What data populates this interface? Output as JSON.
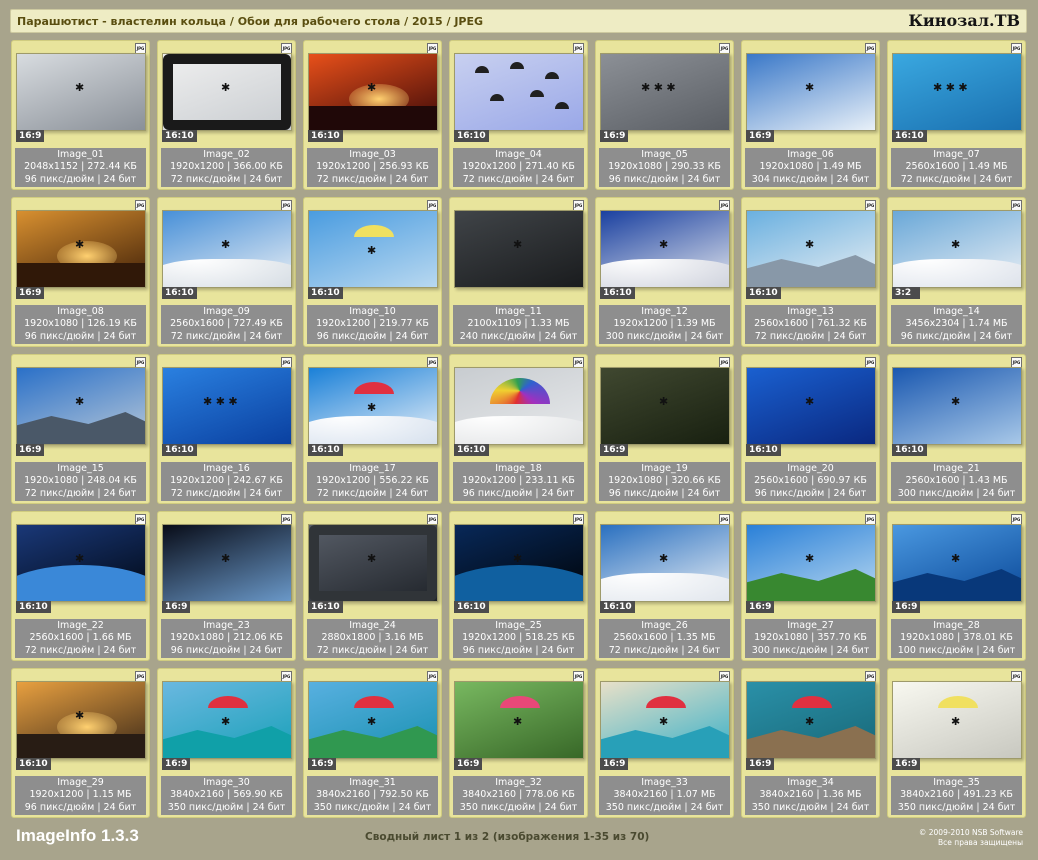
{
  "header": {
    "path": "Парашютист - властелин кольца / Обои для рабочего стола / 2015 / JPEG",
    "brand": "Кинозал.ТВ"
  },
  "footer": {
    "app_name": "ImageInfo 1.3.3",
    "summary": "Сводный лист 1 из 2 (изображения 1-35 из 70)",
    "copyright": "© 2009-2010 NSB Software",
    "rights": "Все права защищены"
  },
  "format_label": "JPG",
  "icons": {
    "format_badge": "jpg-file-icon"
  },
  "images": [
    {
      "name": "Image_01",
      "ratio": "16:9",
      "dims": "2048x1152 | 272.44 КБ",
      "info": "96 пикс/дюйм | 24 бит",
      "sky": "#d8dce0",
      "sky2": "#8a9098",
      "ground": "#3a3e44",
      "scene": "air"
    },
    {
      "name": "Image_02",
      "ratio": "16:10",
      "dims": "1920x1200 | 366.00 КБ",
      "info": "72 пикс/дюйм | 24 бит",
      "sky": "#f0f0f0",
      "sky2": "#c8ccd0",
      "ground": "#1a1a1a",
      "scene": "plane"
    },
    {
      "name": "Image_03",
      "ratio": "16:10",
      "dims": "1920x1200 | 256.93 КБ",
      "info": "72 пикс/дюйм | 24 бит",
      "sky": "#e8501a",
      "sky2": "#3a0808",
      "ground": "#200808",
      "scene": "sunset"
    },
    {
      "name": "Image_04",
      "ratio": "16:10",
      "dims": "1920x1200 | 271.40 КБ",
      "info": "72 пикс/дюйм | 24 бит",
      "sky": "#c8d0f0",
      "sky2": "#9aa8e8",
      "ground": "#b0bce8",
      "scene": "many"
    },
    {
      "name": "Image_05",
      "ratio": "16:9",
      "dims": "1920x1080 | 290.33 КБ",
      "info": "96 пикс/дюйм | 24 бит",
      "sky": "#8c9096",
      "sky2": "#5a5e64",
      "ground": "#6e7276",
      "scene": "formation"
    },
    {
      "name": "Image_06",
      "ratio": "16:9",
      "dims": "1920x1080 | 1.49 МБ",
      "info": "304 пикс/дюйм | 24 бит",
      "sky": "#3a78c8",
      "sky2": "#e8f0f8",
      "ground": "#2060b0",
      "scene": "freefall"
    },
    {
      "name": "Image_07",
      "ratio": "16:10",
      "dims": "2560x1600 | 1.49 МБ",
      "info": "72 пикс/дюйм | 24 бит",
      "sky": "#3aa8e0",
      "sky2": "#1a70b0",
      "ground": "#1a88c8",
      "scene": "ring"
    },
    {
      "name": "Image_08",
      "ratio": "16:9",
      "dims": "1920x1080 | 126.19 КБ",
      "info": "96 пикс/дюйм | 24 бит",
      "sky": "#d89030",
      "sky2": "#402008",
      "ground": "#301808",
      "scene": "sunset"
    },
    {
      "name": "Image_09",
      "ratio": "16:10",
      "dims": "2560x1600 | 727.49 КБ",
      "info": "72 пикс/дюйм | 24 бит",
      "sky": "#4890d8",
      "sky2": "#e8eef4",
      "ground": "#d0d8e0",
      "scene": "clouds"
    },
    {
      "name": "Image_10",
      "ratio": "16:10",
      "dims": "1920x1200 | 219.77 КБ",
      "info": "96 пикс/дюйм | 24 бит",
      "sky": "#4a9ce0",
      "sky2": "#b8d8f0",
      "ground": "#2a78c8",
      "scene": "paraglider"
    },
    {
      "name": "Image_11",
      "ratio": "",
      "dims": "2100x1109 | 1.33 МБ",
      "info": "240 пикс/дюйм | 24 бит",
      "sky": "#404448",
      "sky2": "#1a1c1e",
      "ground": "#2a2c2e",
      "scene": "dark"
    },
    {
      "name": "Image_12",
      "ratio": "16:10",
      "dims": "1920x1200 | 1.39 МБ",
      "info": "300 пикс/дюйм | 24 бит",
      "sky": "#1a40a0",
      "sky2": "#e0e4ec",
      "ground": "#c8ccd8",
      "scene": "clouds"
    },
    {
      "name": "Image_13",
      "ratio": "16:10",
      "dims": "2560x1600 | 761.32 КБ",
      "info": "72 пикс/дюйм | 24 бит",
      "sky": "#6ab0e0",
      "sky2": "#e8eef2",
      "ground": "#8898a8",
      "scene": "mountain"
    },
    {
      "name": "Image_14",
      "ratio": "3:2",
      "dims": "3456x2304 | 1.74 МБ",
      "info": "96 пикс/дюйм | 24 бит",
      "sky": "#6aa8d8",
      "sky2": "#e8eef4",
      "ground": "#d8dee8",
      "scene": "tandem"
    },
    {
      "name": "Image_15",
      "ratio": "16:9",
      "dims": "1920x1080 | 248.04 КБ",
      "info": "72 пикс/дюйм | 24 бит",
      "sky": "#2a70c8",
      "sky2": "#b8c8d8",
      "ground": "#4a5868",
      "scene": "city"
    },
    {
      "name": "Image_16",
      "ratio": "16:10",
      "dims": "1920x1200 | 242.67 КБ",
      "info": "72 пикс/дюйм | 24 бит",
      "sky": "#2a80e0",
      "sky2": "#0a40a0",
      "ground": "#1a60c0",
      "scene": "formation"
    },
    {
      "name": "Image_17",
      "ratio": "16:10",
      "dims": "1920x1200 | 556.22 КБ",
      "info": "72 пикс/дюйм | 24 бит",
      "sky": "#1a80d8",
      "sky2": "#e8f0f8",
      "ground": "#d0dceb",
      "scene": "redwing"
    },
    {
      "name": "Image_18",
      "ratio": "16:10",
      "dims": "1920x1200 | 233.11 КБ",
      "info": "96 пикс/дюйм | 24 бит",
      "sky": "#c8ccd0",
      "sky2": "#e8eaec",
      "ground": "#dcdee0",
      "scene": "rainbow"
    },
    {
      "name": "Image_19",
      "ratio": "16:9",
      "dims": "1920x1080 | 320.66 КБ",
      "info": "96 пикс/дюйм | 24 бит",
      "sky": "#404830",
      "sky2": "#182010",
      "ground": "#284018",
      "scene": "dark"
    },
    {
      "name": "Image_20",
      "ratio": "16:10",
      "dims": "2560x1600 | 690.97 КБ",
      "info": "96 пикс/дюйм | 24 бит",
      "sky": "#1a60d0",
      "sky2": "#0a2880",
      "ground": "#1040a8",
      "scene": "freefall"
    },
    {
      "name": "Image_21",
      "ratio": "16:10",
      "dims": "2560x1600 | 1.43 МБ",
      "info": "300 пикс/дюйм | 24 бит",
      "sky": "#1a58b0",
      "sky2": "#a8c8e8",
      "ground": "#88a8c8",
      "scene": "suit"
    },
    {
      "name": "Image_22",
      "ratio": "16:10",
      "dims": "2560x1600 | 1.66 МБ",
      "info": "72 пикс/дюйм | 24 бит",
      "sky": "#1a3878",
      "sky2": "#000814",
      "ground": "#3a88d8",
      "scene": "space"
    },
    {
      "name": "Image_23",
      "ratio": "16:9",
      "dims": "1920x1080 | 212.06 КБ",
      "info": "96 пикс/дюйм | 24 бит",
      "sky": "#080c18",
      "sky2": "#6a98c8",
      "ground": "#a8c8e0",
      "scene": "suit"
    },
    {
      "name": "Image_24",
      "ratio": "16:10",
      "dims": "2880x1800 | 3.16 МБ",
      "info": "72 пикс/дюйм | 24 бит",
      "sky": "#585e68",
      "sky2": "#20242a",
      "ground": "#303438",
      "scene": "capsule"
    },
    {
      "name": "Image_25",
      "ratio": "16:10",
      "dims": "1920x1200 | 518.25 КБ",
      "info": "96 пикс/дюйм | 24 бит",
      "sky": "#082858",
      "sky2": "#000408",
      "ground": "#1060a0",
      "scene": "space"
    },
    {
      "name": "Image_26",
      "ratio": "16:10",
      "dims": "2560x1600 | 1.35 МБ",
      "info": "72 пикс/дюйм | 24 бит",
      "sky": "#2a70c0",
      "sky2": "#e8eef4",
      "ground": "#dce2ea",
      "scene": "clouds"
    },
    {
      "name": "Image_27",
      "ratio": "16:9",
      "dims": "1920x1080 | 357.70 КБ",
      "info": "300 пикс/дюйм | 24 бит",
      "sky": "#2a80d8",
      "sky2": "#b8d8f0",
      "ground": "#388830",
      "scene": "island"
    },
    {
      "name": "Image_28",
      "ratio": "16:9",
      "dims": "1920x1080 | 378.01 КБ",
      "info": "100 пикс/дюйм | 24 бит",
      "sky": "#4a98e0",
      "sky2": "#0a4898",
      "ground": "#08387a",
      "scene": "cliff"
    },
    {
      "name": "Image_29",
      "ratio": "16:10",
      "dims": "1920x1200 | 1.15 МБ",
      "info": "96 пикс/дюйм | 24 бит",
      "sky": "#e8a040",
      "sky2": "#3a2818",
      "ground": "#281c14",
      "scene": "sunset"
    },
    {
      "name": "Image_30",
      "ratio": "16:9",
      "dims": "3840x2160 | 569.90 КБ",
      "info": "350 пикс/дюйм | 24 бит",
      "sky": "#6ab8e0",
      "sky2": "#18a0b8",
      "ground": "#10a0a8",
      "scene": "coast"
    },
    {
      "name": "Image_31",
      "ratio": "16:9",
      "dims": "3840x2160 | 792.50 КБ",
      "info": "350 пикс/дюйм | 24 бит",
      "sky": "#58b0e0",
      "sky2": "#1890b0",
      "ground": "#309850",
      "scene": "coast"
    },
    {
      "name": "Image_32",
      "ratio": "16:9",
      "dims": "3840x2160 | 778.06 КБ",
      "info": "350 пикс/дюйм | 24 бит",
      "sky": "#78b860",
      "sky2": "#386828",
      "ground": "#487830",
      "scene": "pinkwing"
    },
    {
      "name": "Image_33",
      "ratio": "16:9",
      "dims": "3840x2160 | 1.07 МБ",
      "info": "350 пикс/дюйм | 24 бит",
      "sky": "#e8e0c8",
      "sky2": "#38b0c8",
      "ground": "#28a0b8",
      "scene": "coast"
    },
    {
      "name": "Image_34",
      "ratio": "16:9",
      "dims": "3840x2160 | 1.36 МБ",
      "info": "350 пикс/дюйм | 24 бит",
      "sky": "#2a90a8",
      "sky2": "#186878",
      "ground": "#8a7050",
      "scene": "coast"
    },
    {
      "name": "Image_35",
      "ratio": "16:9",
      "dims": "3840x2160 | 491.23 КБ",
      "info": "350 пикс/дюйм | 24 бит",
      "sky": "#f8f8f0",
      "sky2": "#c8c8c0",
      "ground": "#e0e0d8",
      "scene": "paraglider"
    }
  ]
}
